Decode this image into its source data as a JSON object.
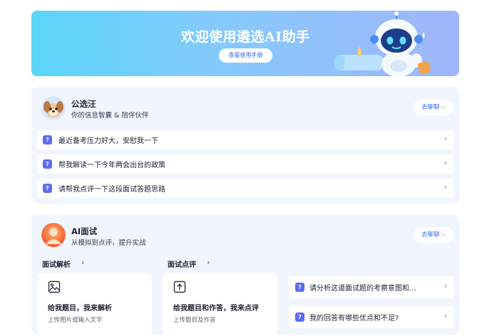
{
  "banner": {
    "title": "欢迎使用遴选AI助手",
    "button_label": "查看使用手册"
  },
  "agents": [
    {
      "name": "公选汪",
      "desc": "你的信息智囊 & 陪伴伙伴",
      "chat_label": "去聊聊",
      "questions": [
        "最近备考压力好大，安慰我一下",
        "帮我解读一下今年两会出台的政策",
        "请帮我点评一下这段面试答题思路"
      ]
    },
    {
      "name": "AI面试",
      "desc": "从模拟到点评，提升实战",
      "chat_label": "去聊聊",
      "sections": [
        {
          "label": "面试解析",
          "tool_title": "给我题目，我来解析",
          "tool_sub": "上传图片或输入文字"
        },
        {
          "label": "面试点评",
          "tool_title": "给我题目和作答，我来点评",
          "tool_sub": "上传题目及作答"
        }
      ],
      "questions": [
        "请分析这道面试题的考察意图和…",
        "我的回答有哪些优点和不足?"
      ]
    }
  ],
  "icons": {
    "chevron": "›",
    "double_chevron": "››",
    "question": "?"
  },
  "colors": {
    "accent": "#3a6df0",
    "question_badge": "#5b6cf5",
    "card_bg": "#f1f5fe"
  }
}
